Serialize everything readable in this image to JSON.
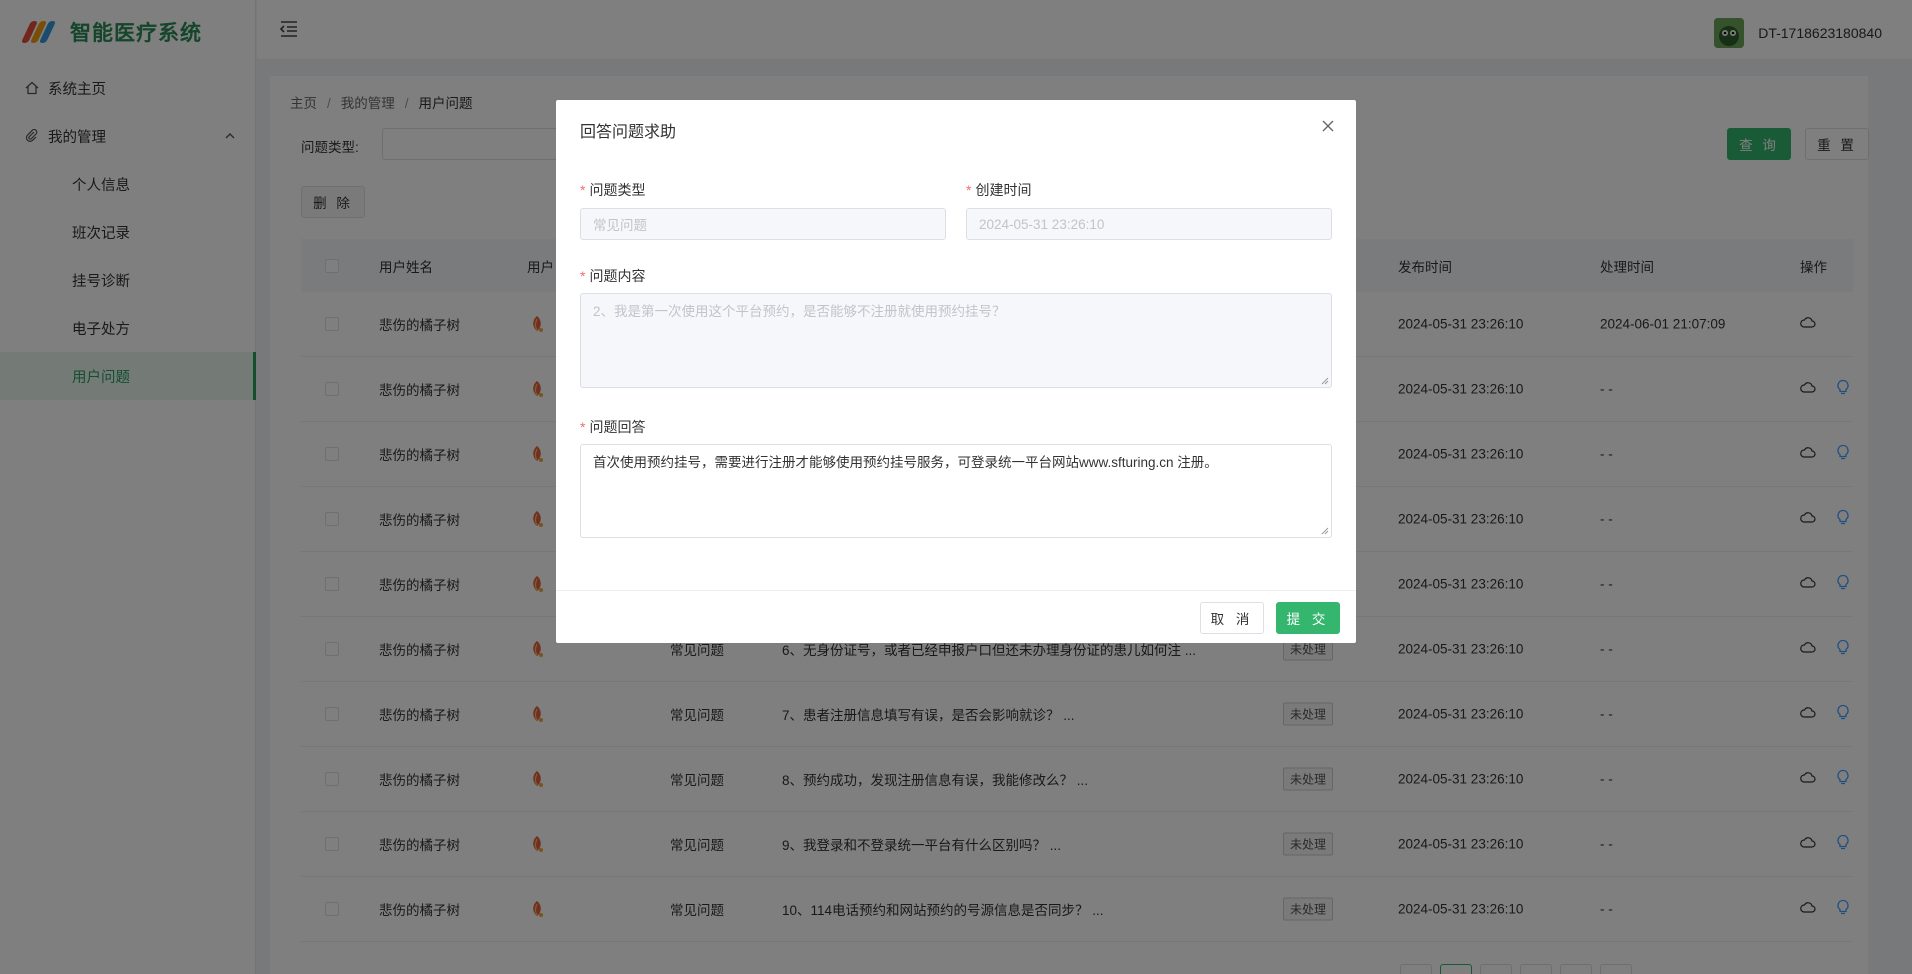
{
  "app": {
    "title": "智能医疗系统",
    "user": "DT-1718623180840"
  },
  "colors": {
    "brand": "#2a8a57",
    "primary": "#35b66e",
    "required": "#f56c6c",
    "link_icon": "#409eff"
  },
  "sidebar": {
    "home": "系统主页",
    "group": "我的管理",
    "items": [
      {
        "label": "个人信息"
      },
      {
        "label": "班次记录"
      },
      {
        "label": "挂号诊断"
      },
      {
        "label": "电子处方"
      },
      {
        "label": "用户问题"
      }
    ],
    "active": "用户问题"
  },
  "breadcrumb": {
    "home": "主页",
    "parent": "我的管理",
    "current": "用户问题",
    "sep": "/"
  },
  "filter": {
    "label": "问题类型:",
    "query_button": "查 询",
    "reset_button": "重 置",
    "delete_button": "删 除"
  },
  "table": {
    "headers": {
      "name": "用户姓名",
      "avatar": "用户",
      "publish": "发布时间",
      "process": "处理时间",
      "ops": "操作"
    },
    "rows": [
      {
        "name": "悲伤的橘子树",
        "type": "",
        "content": "",
        "status": "",
        "publish": "2024-05-31 23:26:10",
        "process": "2024-06-01 21:07:09",
        "answered": true
      },
      {
        "name": "悲伤的橘子树",
        "type": "",
        "content": "",
        "status": "",
        "publish": "2024-05-31 23:26:10",
        "process": "- -",
        "answered": false
      },
      {
        "name": "悲伤的橘子树",
        "type": "",
        "content": "",
        "status": "",
        "publish": "2024-05-31 23:26:10",
        "process": "- -",
        "answered": false
      },
      {
        "name": "悲伤的橘子树",
        "type": "",
        "content": "",
        "status": "",
        "publish": "2024-05-31 23:26:10",
        "process": "- -",
        "answered": false
      },
      {
        "name": "悲伤的橘子树",
        "type": "",
        "content": "",
        "status": "",
        "publish": "2024-05-31 23:26:10",
        "process": "- -",
        "answered": false
      },
      {
        "name": "悲伤的橘子树",
        "type": "常见问题",
        "content": "6、无身份证号，或者已经申报户口但还未办理身份证的患儿如何注 ...",
        "status": "未处理",
        "publish": "2024-05-31 23:26:10",
        "process": "- -",
        "answered": false
      },
      {
        "name": "悲伤的橘子树",
        "type": "常见问题",
        "content": "7、患者注册信息填写有误，是否会影响就诊？ ...",
        "status": "未处理",
        "publish": "2024-05-31 23:26:10",
        "process": "- -",
        "answered": false
      },
      {
        "name": "悲伤的橘子树",
        "type": "常见问题",
        "content": "8、预约成功，发现注册信息有误，我能修改么？ ...",
        "status": "未处理",
        "publish": "2024-05-31 23:26:10",
        "process": "- -",
        "answered": false
      },
      {
        "name": "悲伤的橘子树",
        "type": "常见问题",
        "content": "9、我登录和不登录统一平台有什么区别吗？ ...",
        "status": "未处理",
        "publish": "2024-05-31 23:26:10",
        "process": "- -",
        "answered": false
      },
      {
        "name": "悲伤的橘子树",
        "type": "常见问题",
        "content": "10、114电话预约和网站预约的号源信息是否同步？ ...",
        "status": "未处理",
        "publish": "2024-05-31 23:26:10",
        "process": "- -",
        "answered": false
      }
    ]
  },
  "dialog": {
    "title": "回答问题求助",
    "required_mark": "*",
    "fields": {
      "type_label": "问题类型",
      "type_value": "常见问题",
      "time_label": "创建时间",
      "time_value": "2024-05-31 23:26:10",
      "content_label": "问题内容",
      "content_value": "2、我是第一次使用这个平台预约，是否能够不注册就使用预约挂号？",
      "answer_label": "问题回答",
      "answer_value": "首次使用预约挂号，需要进行注册才能够使用预约挂号服务，可登录统一平台网站www.sfturing.cn 注册。"
    },
    "cancel_button": "取 消",
    "submit_button": "提 交"
  }
}
